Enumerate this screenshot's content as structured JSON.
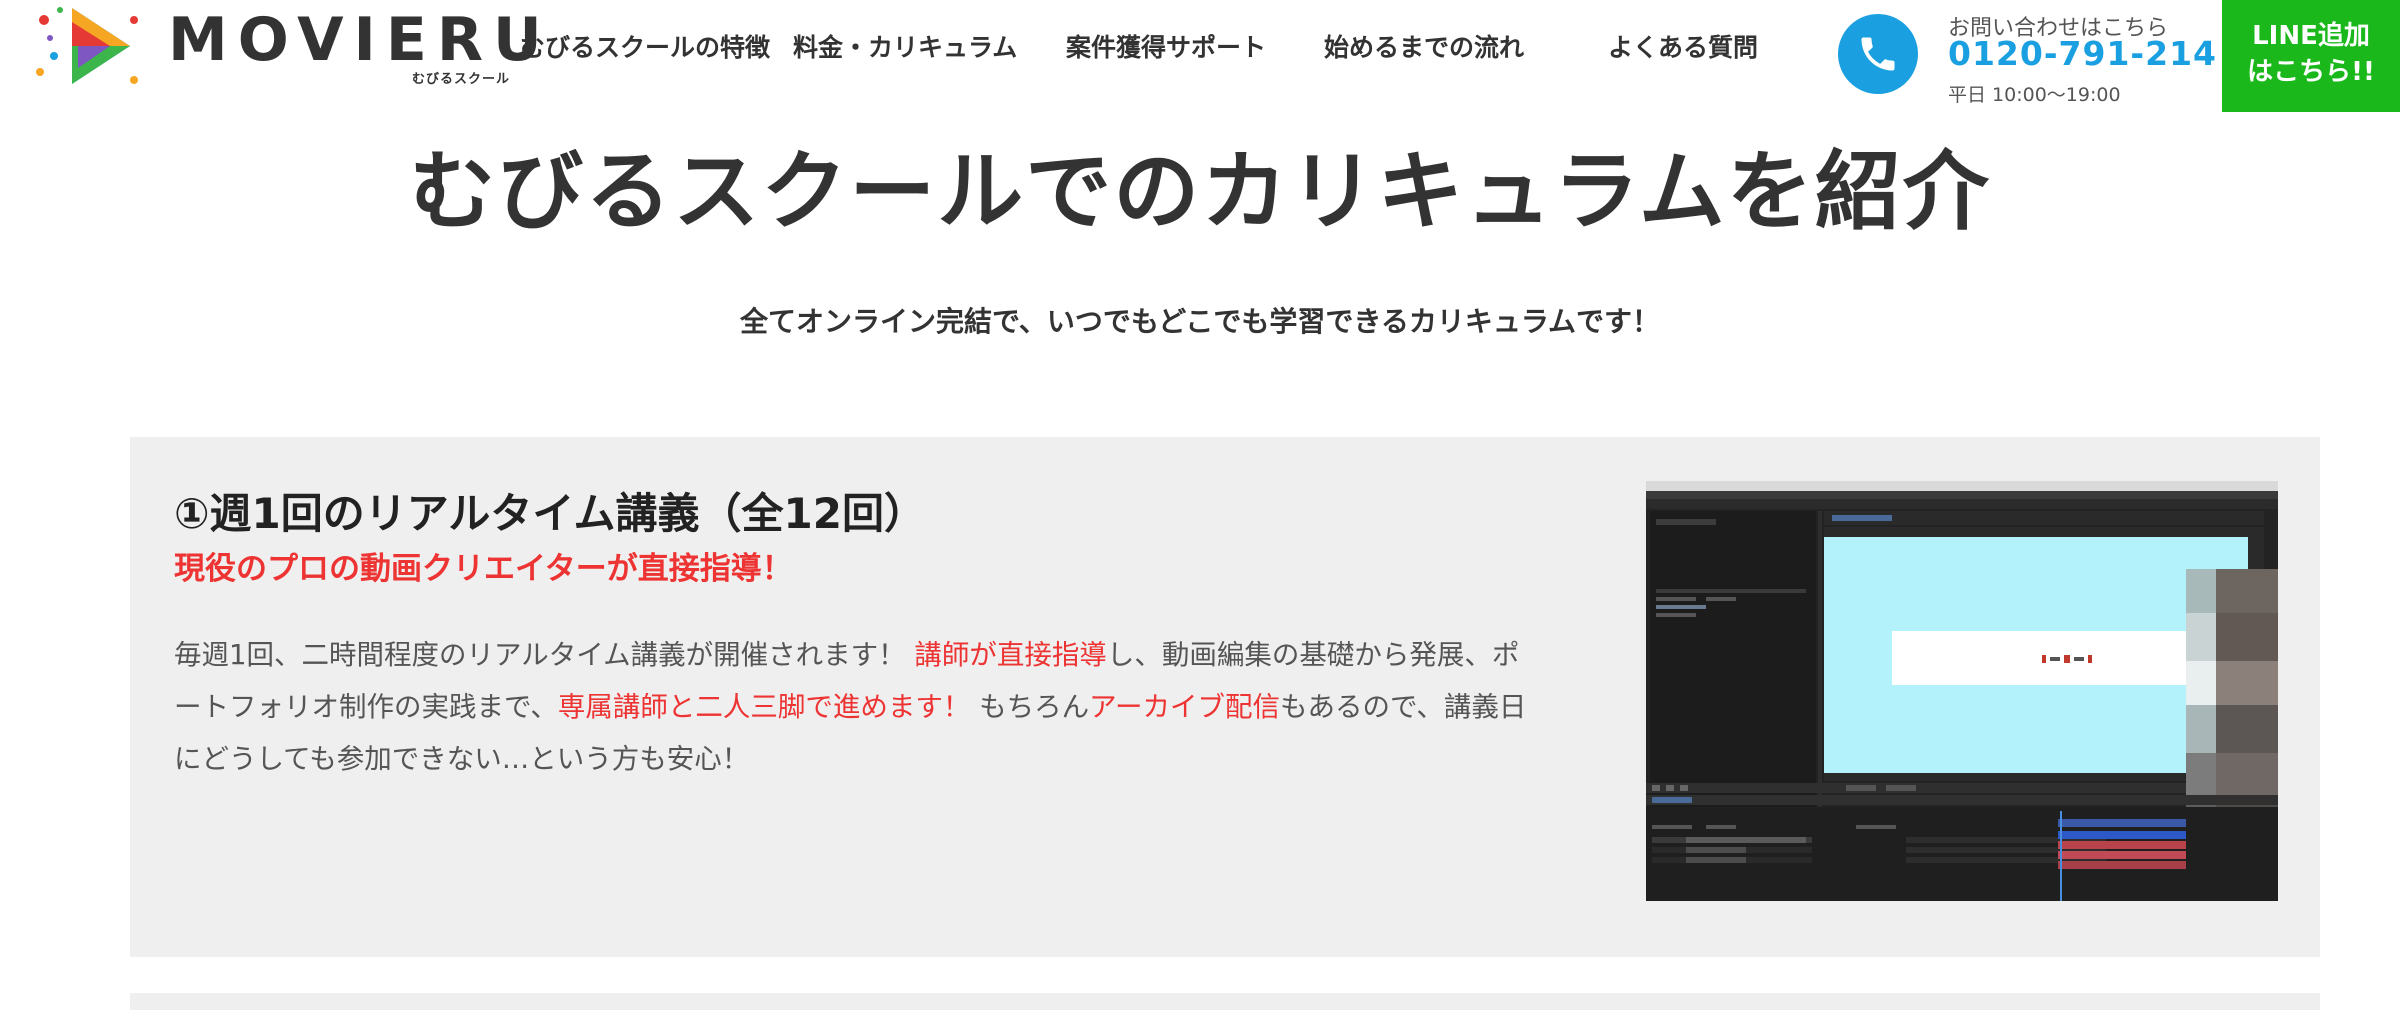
{
  "header": {
    "logo": {
      "text": "MOVIERU",
      "subtext": "むびるスクール"
    },
    "nav": [
      {
        "label": "むびるスクールの特徴"
      },
      {
        "label": "料金・カリキュラム"
      },
      {
        "label": "案件獲得サポート"
      },
      {
        "label": "始めるまでの流れ"
      },
      {
        "label": "よくある質問"
      }
    ],
    "contact": {
      "label": "お問い合わせはこちら",
      "phone": "0120-791-214",
      "hours": "平日 10:00〜19:00"
    },
    "line_button": {
      "line1": "LINE追加",
      "line2": "はこちら!!"
    }
  },
  "main": {
    "title": "むびるスクールでのカリキュラムを紹介",
    "lead": "全てオンライン完結で、いつでもどこでも学習できるカリキュラムです！",
    "card": {
      "title": "①週1回のリアルタイム講義（全12回）",
      "subtitle": "現役のプロの動画クリエイターが直接指導！",
      "body": {
        "p1": "毎週1回、二時間程度のリアルタイム講義が開催されます！ ",
        "h1": "講師が直接指導",
        "p2": "し、動画編集の基礎から発展、ポートフォリオ制作の実践まで、",
        "h2": "専属講師と二人三脚で進めます！",
        "p3": " もちろん",
        "h3": "アーカイブ配信",
        "p4": "もあるので、講義日にどうしても参加できない…という方も安心！"
      }
    }
  },
  "colors": {
    "accent_blue": "#1a9fe0",
    "line_green": "#1bb81b",
    "highlight_red": "#ee3333",
    "card_bg": "#efefef"
  },
  "icons": {
    "phone": "phone-icon",
    "logo_mark": "play-triangle-icon"
  }
}
